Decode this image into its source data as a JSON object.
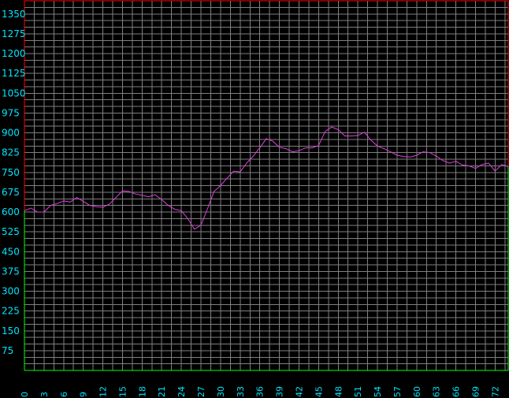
{
  "chart_data": {
    "type": "line",
    "title": "",
    "xlabel": "",
    "ylabel": "",
    "xlim": [
      0,
      74
    ],
    "ylim": [
      0,
      1400
    ],
    "x_ticks": [
      0,
      3,
      6,
      9,
      12,
      15,
      18,
      21,
      24,
      27,
      30,
      33,
      36,
      39,
      42,
      45,
      48,
      51,
      54,
      57,
      60,
      63,
      66,
      69,
      72
    ],
    "y_ticks": [
      75,
      150,
      225,
      300,
      375,
      450,
      525,
      600,
      675,
      750,
      825,
      900,
      975,
      1050,
      1125,
      1200,
      1275,
      1350
    ],
    "grid": true,
    "colors": {
      "background": "#000000",
      "grid": "#808080",
      "series": "#e040e0",
      "labels": "#00e5ff",
      "frame_top": "#ff0000",
      "frame_bottom": "#00ff00"
    },
    "series": [
      {
        "x": [
          0,
          1,
          2,
          3,
          4,
          5,
          6,
          7,
          8,
          9,
          10,
          11,
          12,
          13,
          14,
          15,
          16,
          17,
          18,
          19,
          20,
          21,
          22,
          23,
          24,
          25,
          26,
          27,
          28,
          29,
          30,
          31,
          32,
          33,
          34,
          35,
          36,
          37,
          38,
          39,
          40,
          41,
          42,
          43,
          44,
          45,
          46,
          47,
          48,
          49,
          50,
          51,
          52,
          53,
          54,
          55,
          56,
          57,
          58,
          59,
          60,
          61,
          62,
          63,
          64,
          65,
          66,
          67,
          68,
          69,
          70,
          71,
          72,
          73,
          74
        ],
        "values": [
          605,
          615,
          600,
          600,
          625,
          632,
          642,
          638,
          655,
          640,
          625,
          620,
          618,
          630,
          655,
          680,
          678,
          668,
          663,
          658,
          665,
          647,
          625,
          610,
          605,
          575,
          535,
          550,
          612,
          678,
          700,
          728,
          755,
          752,
          785,
          812,
          843,
          878,
          868,
          845,
          840,
          828,
          832,
          843,
          843,
          852,
          905,
          922,
          912,
          888,
          888,
          890,
          902,
          872,
          850,
          840,
          828,
          815,
          810,
          808,
          815,
          828,
          825,
          812,
          795,
          785,
          792,
          778,
          775,
          765,
          780,
          785,
          755,
          780,
          772
        ]
      }
    ]
  }
}
